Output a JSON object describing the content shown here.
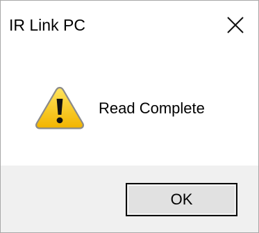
{
  "window": {
    "title": "IR Link PC"
  },
  "message": {
    "text": "Read Complete",
    "icon": "warning-icon"
  },
  "buttons": {
    "ok_label": "OK"
  },
  "colors": {
    "warning_fill": "#f7c600",
    "footer_background": "#f0f0f0",
    "button_background": "#e1e1e1"
  }
}
